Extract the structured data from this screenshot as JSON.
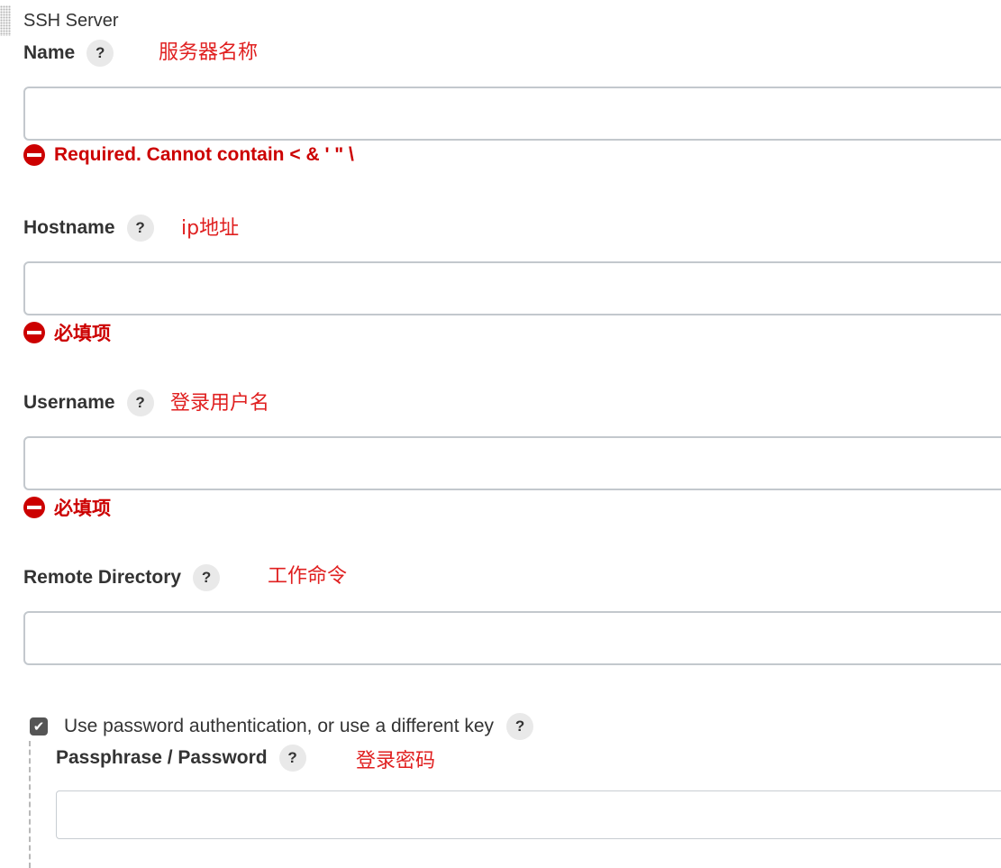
{
  "section": {
    "title": "SSH Server"
  },
  "fields": {
    "name": {
      "label": "Name",
      "help": "?",
      "note": "服务器名称",
      "value": "",
      "error": "Required. Cannot contain < & ' \" \\"
    },
    "hostname": {
      "label": "Hostname",
      "help": "?",
      "note": "ip地址",
      "value": "",
      "error": "必填项"
    },
    "username": {
      "label": "Username",
      "help": "?",
      "note": "登录用户名",
      "value": "",
      "error": "必填项"
    },
    "remote_directory": {
      "label": "Remote Directory",
      "help": "?",
      "note": "工作命令",
      "value": ""
    },
    "use_password": {
      "label": "Use password authentication, or use a different key",
      "checked": true,
      "help": "?"
    },
    "passphrase": {
      "label": "Passphrase / Password",
      "help": "?",
      "note": "登录密码",
      "value": ""
    }
  },
  "icons": {
    "error": "error-circle-icon",
    "check": "checkmark-icon"
  },
  "colors": {
    "error": "#cc0000",
    "annotation": "#e02020",
    "input_border": "#c3c8cd",
    "help_bg": "#e9e9e9"
  }
}
